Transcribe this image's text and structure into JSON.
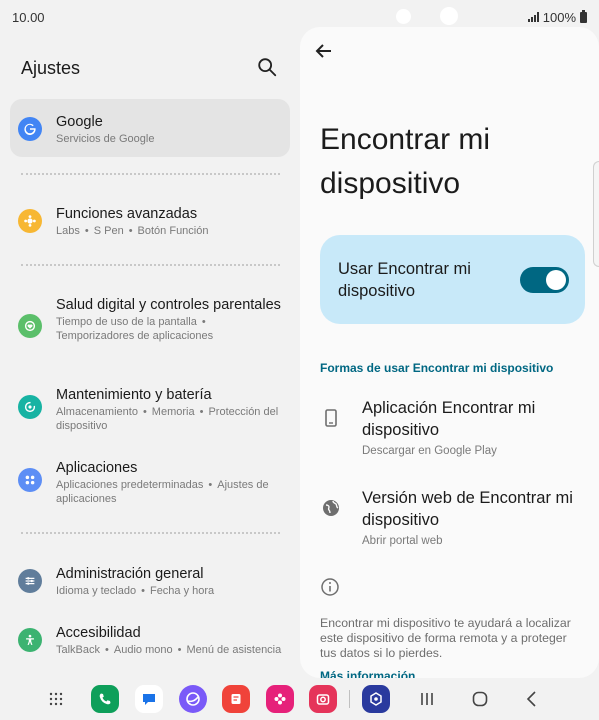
{
  "status_bar": {
    "time": "10.00",
    "battery": "100%"
  },
  "left": {
    "title": "Ajustes",
    "items": [
      {
        "title": "Google",
        "sub": "Servicios de Google",
        "icon": "google-icon",
        "color": "#4285f4"
      },
      {
        "title": "Funciones avanzadas",
        "sub_parts": [
          "Labs",
          "S Pen",
          "Botón Función"
        ],
        "icon": "advanced-features-icon",
        "color": "#f7b733"
      },
      {
        "title": "Salud digital y controles parentales",
        "sub_parts": [
          "Tiempo de uso de la pantalla",
          "Temporizadores de aplicaciones"
        ],
        "icon": "digital-wellbeing-icon",
        "color": "#5bbf6a"
      },
      {
        "title": "Mantenimiento y batería",
        "sub_parts": [
          "Almacenamiento",
          "Memoria",
          "Protección del dispositivo"
        ],
        "icon": "maintenance-icon",
        "color": "#17b3a3"
      },
      {
        "title": "Aplicaciones",
        "sub_parts": [
          "Aplicaciones predeterminadas",
          "Ajustes de aplicaciones"
        ],
        "icon": "apps-icon",
        "color": "#5d8ef5"
      },
      {
        "title": "Administración general",
        "sub_parts": [
          "Idioma y teclado",
          "Fecha y hora"
        ],
        "icon": "general-management-icon",
        "color": "#607d9b"
      },
      {
        "title": "Accesibilidad",
        "sub_parts": [
          "TalkBack",
          "Audio mono",
          "Menú de asistencia"
        ],
        "icon": "accessibility-icon",
        "color": "#3cb371"
      }
    ]
  },
  "right": {
    "title": "Encontrar mi dispositivo",
    "toggle_label": "Usar Encontrar mi dispositivo",
    "toggle_on": true,
    "section_header": "Formas de usar Encontrar mi dispositivo",
    "options": [
      {
        "title": "Aplicación Encontrar mi dispositivo",
        "sub": "Descargar en Google Play",
        "icon": "phone-icon"
      },
      {
        "title": "Versión web de Encontrar mi dispositivo",
        "sub": "Abrir portal web",
        "icon": "globe-icon"
      }
    ],
    "info_text": "Encontrar mi dispositivo te ayudará a localizar este dispositivo de forma remota y a proteger tus datos si lo pierdes.",
    "more_link": "Más información"
  },
  "colors": {
    "accent": "#006782",
    "card": "#c8e9f9"
  },
  "nav": {
    "apps": [
      {
        "name": "phone-app-icon",
        "color": "#0e9f5a"
      },
      {
        "name": "messages-app-icon",
        "color": "#ffffff"
      },
      {
        "name": "internet-app-icon",
        "color": "#7a5af8"
      },
      {
        "name": "notes-app-icon",
        "color": "#f0433a"
      },
      {
        "name": "bixby-app-icon",
        "color": "#e6217a"
      },
      {
        "name": "camera-app-icon",
        "color": "#e5345a"
      },
      {
        "name": "security-app-icon",
        "color": "#2a3a9e"
      }
    ]
  }
}
